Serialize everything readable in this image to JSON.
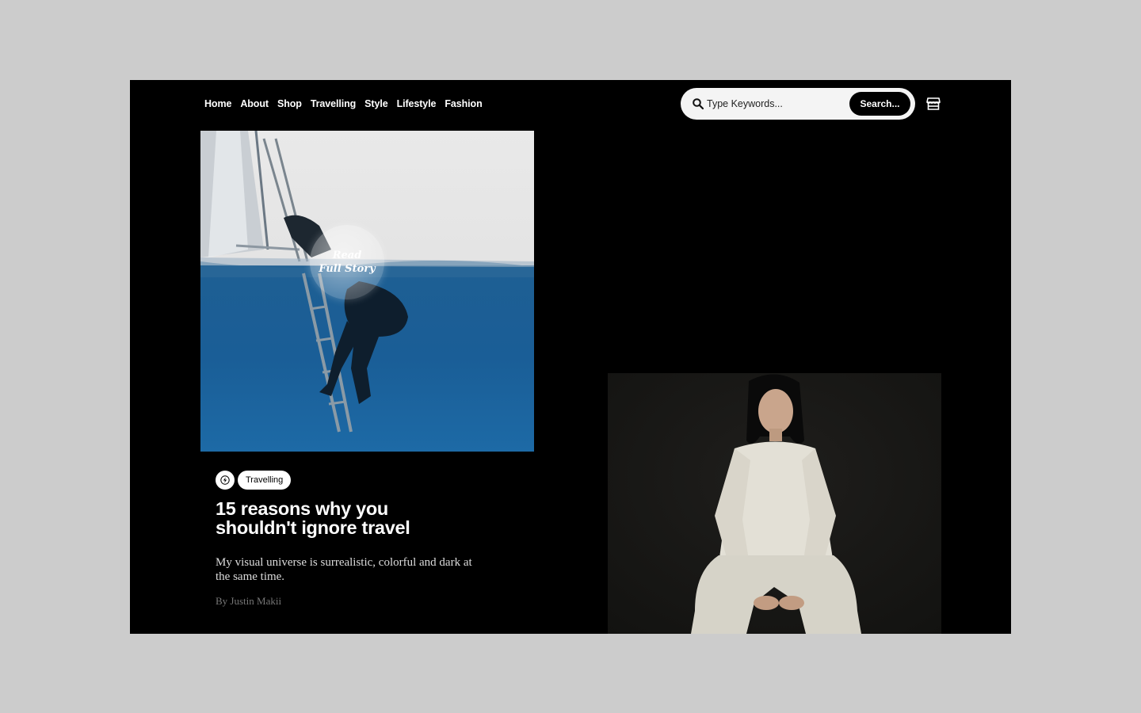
{
  "nav": {
    "items": [
      "Home",
      "About",
      "Shop",
      "Travelling",
      "Style",
      "Lifestyle",
      "Fashion"
    ]
  },
  "search": {
    "placeholder": "Type Keywords...",
    "button_label": "Search..."
  },
  "feature": {
    "badge_line1": "Read",
    "badge_line2": "Full Story"
  },
  "post": {
    "category": "Travelling",
    "title": "15 reasons why you shouldn't ignore travel",
    "excerpt": "My visual universe is surrealistic, colorful and dark at the same time.",
    "author": "By Justin Makii"
  },
  "icons": {
    "search": "search-icon",
    "store": "store-icon",
    "category": "bolt-icon"
  },
  "colors": {
    "page_background": "#cccccc",
    "site_background": "#000000",
    "text_primary": "#ffffff",
    "search_field": "#f4f4f4",
    "author_text": "#777777"
  }
}
